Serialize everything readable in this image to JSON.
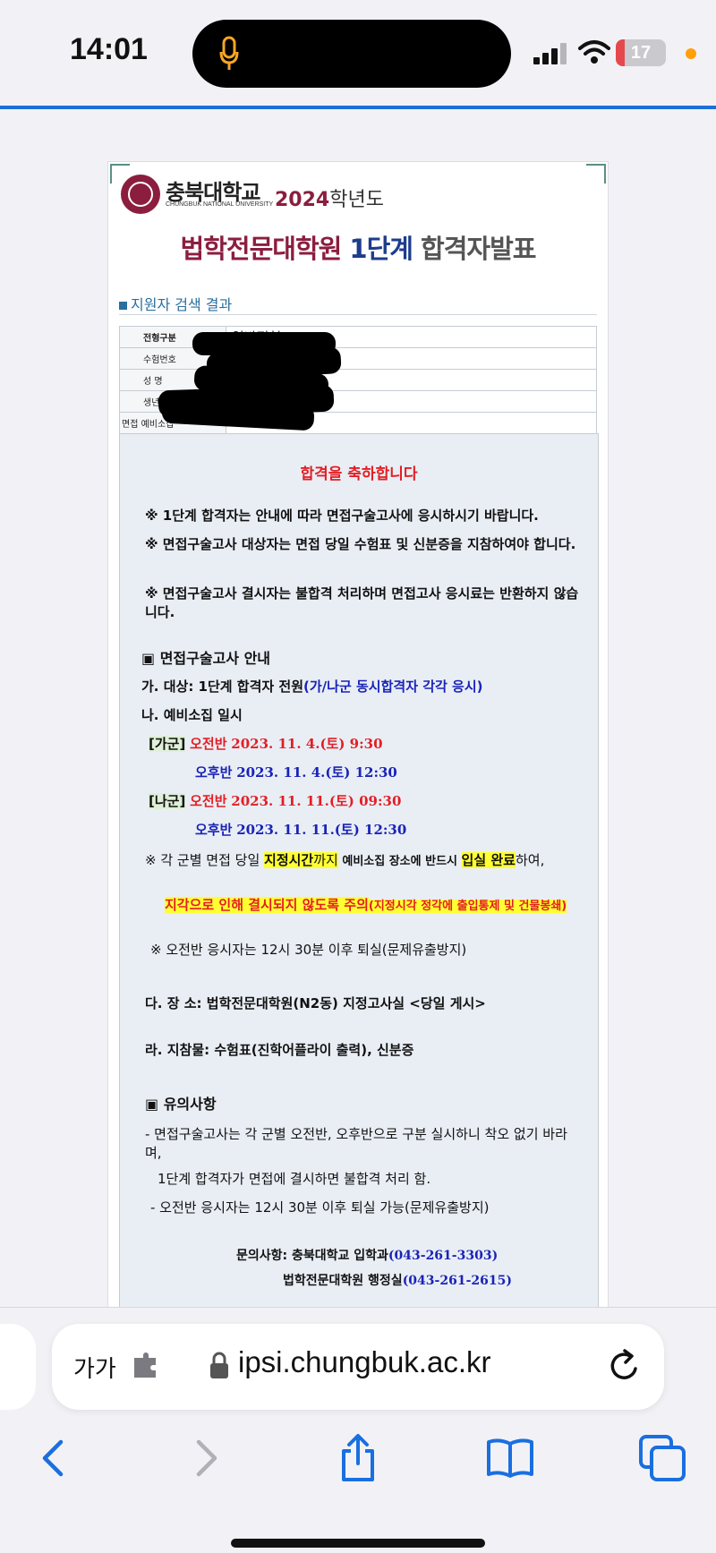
{
  "status": {
    "time": "14:01",
    "battery_level": 17,
    "battery_label": "17"
  },
  "doc": {
    "logo_kor": "충북대학교",
    "logo_eng": "CHUNGBUK NATIONAL UNIVERSITY",
    "year_num": "2024",
    "year_suffix": "학년도",
    "headline_1": "법학전문대학원 ",
    "headline_2": "1단계",
    "headline_3": " 합격자발표",
    "section_title": "지원자 검색 결과",
    "table": [
      {
        "label": "전형구분",
        "value": "일반전형"
      },
      {
        "label": "수험번호",
        "value": ""
      },
      {
        "label": "성    명",
        "value": ""
      },
      {
        "label": "생년월일",
        "value": ""
      },
      {
        "label": "면접 예비소집",
        "value": ""
      }
    ],
    "congrats": "합격을 축하합니다",
    "notes": [
      "※ 1단계 합격자는 안내에 따라 면접구술고사에 응시하시기 바랍니다.",
      "※ 면접구술고사 대상자는 면접 당일 수험표 및 신분증을 지참하여야 합니다.",
      "※ 면접구술고사 결시자는 불합격 처리하며 면접고사 응시료는 반환하지 않습니다."
    ],
    "guide_title": "▣ 면접구술고사 안내",
    "target_label": "가. 대상: 1단계 합격자 전원",
    "target_note": "(가/나군 동시합격자 각각 응시)",
    "schedule_label": "나. 예비소집 일시",
    "schedule": [
      {
        "group": "[가군]",
        "session": "오전반",
        "datetime": "2023. 11. 4.(토) 9:30"
      },
      {
        "group": "",
        "session": "오후반",
        "datetime": "2023. 11. 4.(토) 12:30"
      },
      {
        "group": "[나군]",
        "session": "오전반",
        "datetime": "2023. 11. 11.(토) 09:30"
      },
      {
        "group": "",
        "session": "오후반",
        "datetime": "2023. 11. 11.(토) 12:30"
      }
    ],
    "arrive_a": "※ 각 군별 면접 당일 ",
    "arrive_b": "지정시간",
    "arrive_c": "까지",
    "arrive_d": " 예비소집 장소에 반드시 ",
    "arrive_e": "입실 완료",
    "arrive_f": "하여,",
    "late_a": "지각으로 인해 결시되지 않도록 주의",
    "late_b": "(지정시각 정각에 출입통제 및 건물봉쇄)",
    "morning_note": "※ 오전반 응시자는 12시 30분 이후 퇴실(문제유출방지)",
    "place": "다. 장 소: 법학전문대학원(N2동) 지정고사실 <당일 게시>",
    "items": "라. 지참물: 수험표(진학어플라이 출력), 신분증",
    "caution_title": "▣ 유의사항",
    "caution_1": "- 면접구술고사는 각 군별 오전반, 오후반으로 구분 실시하니 착오 없기 바라며,",
    "caution_2": "1단계 합격자가 면접에 결시하면 불합격 처리 함.",
    "caution_3": "- 오전반 응시자는 12시 30분 이후 퇴실 가능(문제유출방지)",
    "contact_1_label": "문의사항: 충북대학교 입학과",
    "contact_1_phone": "(043-261-3303)",
    "contact_2_label": "법학전문대학원 행정실",
    "contact_2_phone": "(043-261-2615)"
  },
  "browser": {
    "text_size": "가가",
    "url": "ipsi.chungbuk.ac.kr"
  },
  "icons": {
    "mic": "mic-icon",
    "signal": "signal-icon",
    "wifi": "wifi-icon",
    "extension": "extension-icon",
    "lock": "lock-icon",
    "reload": "reload-icon",
    "back": "back-icon",
    "forward": "forward-icon",
    "share": "share-icon",
    "bookmarks": "bookmarks-icon",
    "tabs": "tabs-icon"
  },
  "colors": {
    "accent": "#1e6fd9",
    "brand": "#8b1e3f",
    "red": "#e31e24",
    "blue": "#1a23b7"
  }
}
